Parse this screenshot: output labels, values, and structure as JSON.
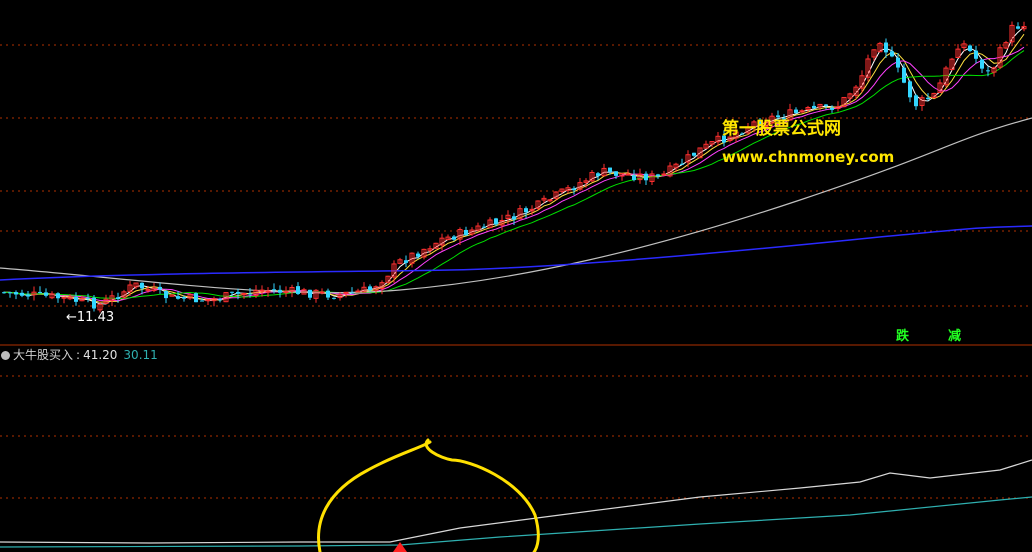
{
  "chart_data": [
    {
      "type": "candlestick",
      "panel": "price",
      "low_annotation": "←11.43",
      "signals": [
        "跌",
        "减"
      ],
      "colors": {
        "up": "#ff3030",
        "down": "#33d6ff",
        "ma5": "#ffffff",
        "ma10": "#ffe040",
        "ma20": "#ff40ff",
        "ma30": "#00e000",
        "ma60": "#c0c0c0",
        "ma120": "#2a2aff",
        "grid": "#b03000",
        "signal": "#22ff22"
      }
    },
    {
      "type": "line",
      "panel": "indicator",
      "name": "大牛股买入",
      "value1": "41.20",
      "value2": "30.11",
      "separator": ":",
      "colors": {
        "line1": "#d8d8d8",
        "line2": "#2fb0b0",
        "circle": "#ffe000",
        "marker": "#ff2020"
      }
    }
  ],
  "watermark": {
    "line1": "第一股票公式网",
    "line2": "www.chnmoney.com"
  }
}
